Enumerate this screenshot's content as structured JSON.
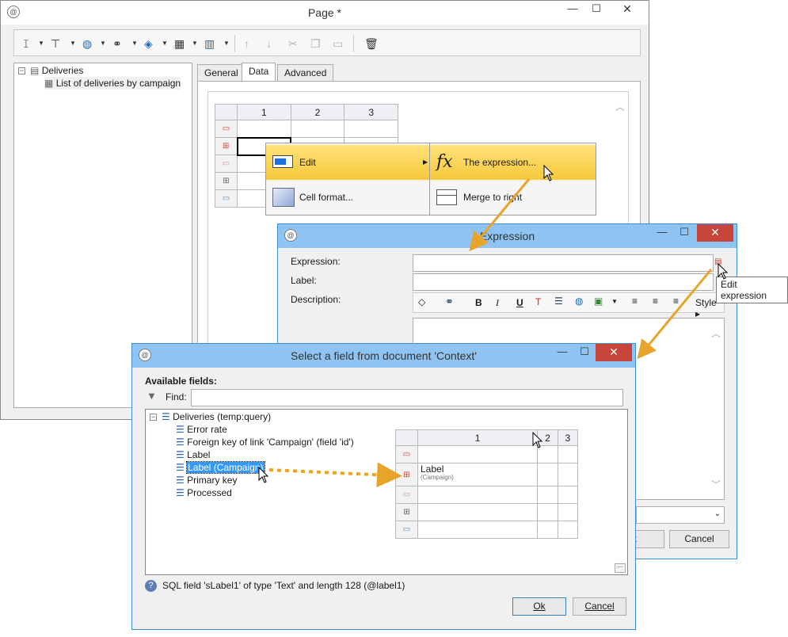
{
  "page_window": {
    "title": "Page *",
    "toolbar": {
      "buttons": [
        {
          "name": "insert-text-icon",
          "glyph": "𝙸"
        },
        {
          "name": "insert-field-icon",
          "glyph": "⊤"
        },
        {
          "name": "insert-web-icon",
          "glyph": "◍"
        },
        {
          "name": "insert-link-icon",
          "glyph": "⚭"
        },
        {
          "name": "insert-block-icon",
          "glyph": "◈"
        },
        {
          "name": "insert-table-icon",
          "glyph": "▦"
        },
        {
          "name": "insert-columns-icon",
          "glyph": "▥"
        },
        {
          "name": "move-up-icon",
          "glyph": "↑"
        },
        {
          "name": "move-down-icon",
          "glyph": "↓"
        },
        {
          "name": "cut-icon",
          "glyph": "✂"
        },
        {
          "name": "copy-icon",
          "glyph": "❐"
        },
        {
          "name": "paste-icon",
          "glyph": "▭"
        },
        {
          "name": "delete-icon",
          "glyph": "🗑"
        }
      ]
    },
    "tree": {
      "root": "Deliveries",
      "child": "List of deliveries by campaign"
    },
    "tabs": [
      "General",
      "Data",
      "Advanced"
    ],
    "grid": {
      "columns": [
        "1",
        "2",
        "3"
      ]
    }
  },
  "context_menu": {
    "left": {
      "edit": "Edit",
      "cell_format": "Cell format..."
    },
    "right": {
      "expression": "The expression...",
      "merge_right": "Merge to right"
    }
  },
  "expression_window": {
    "title": "Expression",
    "fields": {
      "expression": "Expression:",
      "label": "Label:",
      "description": "Description:"
    },
    "editor_toolbar": {
      "style": "Style",
      "bold": "B",
      "italic": "I",
      "underline": "U"
    },
    "tooltip": "Edit expression",
    "buttons": {
      "ok_partial": "k",
      "cancel": "Cancel"
    }
  },
  "select_window": {
    "title": "Select a field from document 'Context'",
    "available_fields": "Available fields:",
    "find_label": "Find:",
    "find_value": "",
    "tree_root": "Deliveries (temp:query)",
    "fields": [
      "Error rate",
      "Foreign key of link 'Campaign' (field 'id')",
      "Label",
      "Label (Campaign)",
      "Primary key",
      "Processed"
    ],
    "selected_field": "Label (Campaign)",
    "preview_grid": {
      "columns": [
        "1",
        "2",
        "3"
      ],
      "cell_label": "Label",
      "cell_label_sub": "(Campaign)"
    },
    "status": "SQL field 'sLabel1' of type 'Text' and length 128 (@label1)",
    "buttons": {
      "ok": "Ok",
      "cancel": "Cancel"
    }
  },
  "colors": {
    "active_title": "#8fc4f2",
    "close_red": "#c7453a",
    "highlight": "#f7c83b",
    "selection": "#3399ff",
    "arrow": "#e8a42a"
  }
}
